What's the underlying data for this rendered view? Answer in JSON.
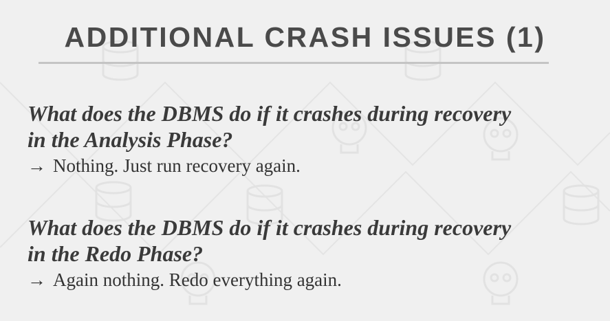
{
  "slide": {
    "title": "ADDITIONAL CRASH ISSUES (1)",
    "items": [
      {
        "question_line1": "What does the DBMS do if it crashes during recovery",
        "question_line2": "in the Analysis Phase?",
        "arrow": "→",
        "answer": "Nothing. Just run recovery again."
      },
      {
        "question_line1": "What does the DBMS do if it crashes during recovery",
        "question_line2": "in the Redo Phase?",
        "arrow": "→",
        "answer": "Again nothing. Redo everything again."
      }
    ]
  },
  "colors": {
    "background": "#f0f0f0",
    "title": "#4a4a4a",
    "rule": "#c4c4c4",
    "text": "#333333",
    "pattern": "#e6e6e6"
  },
  "icons": [
    "database-icon",
    "skull-icon"
  ]
}
